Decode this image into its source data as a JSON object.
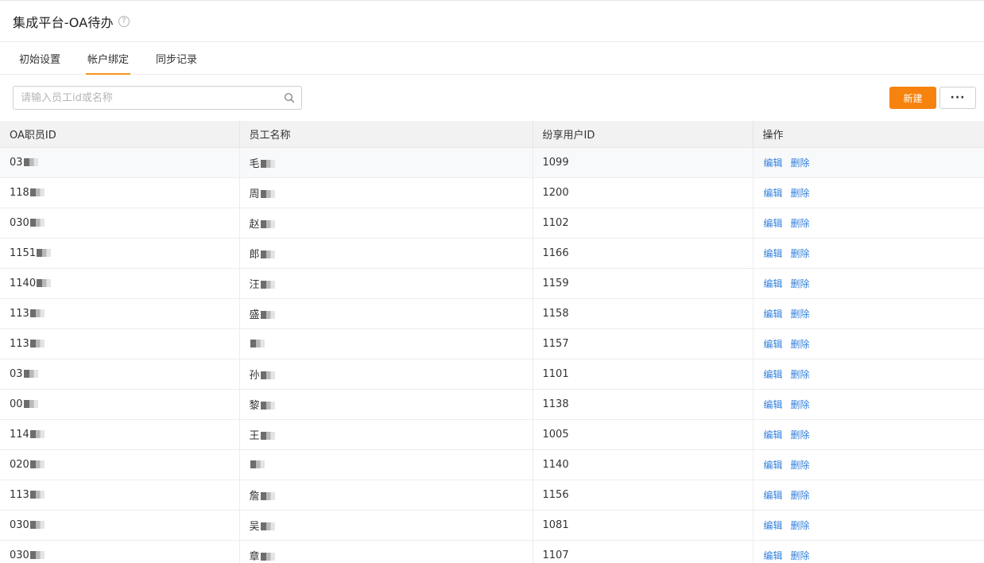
{
  "header": {
    "title": "集成平台-OA待办",
    "help_icon": "question-circle-icon"
  },
  "tabs": [
    {
      "label": "初始设置",
      "active": false
    },
    {
      "label": "帐户绑定",
      "active": true
    },
    {
      "label": "同步记录",
      "active": false
    }
  ],
  "toolbar": {
    "search_placeholder": "请输入员工id或名称",
    "search_value": "",
    "new_label": "新建",
    "more_label": "···"
  },
  "table": {
    "columns": [
      "OA职员ID",
      "员工名称",
      "纷享用户ID",
      "操作"
    ],
    "actions": {
      "edit": "编辑",
      "delete": "删除"
    },
    "rows": [
      {
        "oa_id": "03",
        "name": "毛",
        "share_id": "1099"
      },
      {
        "oa_id": "118",
        "name": "周",
        "share_id": "1200"
      },
      {
        "oa_id": "030",
        "name": "赵",
        "share_id": "1102"
      },
      {
        "oa_id": "1151",
        "name": "郎",
        "share_id": "1166"
      },
      {
        "oa_id": "1140",
        "name": "汪",
        "share_id": "1159"
      },
      {
        "oa_id": "113",
        "name": "盛",
        "share_id": "1158"
      },
      {
        "oa_id": "113",
        "name": "",
        "share_id": "1157"
      },
      {
        "oa_id": "03",
        "name": "孙",
        "share_id": "1101"
      },
      {
        "oa_id": "00",
        "name": "黎",
        "share_id": "1138"
      },
      {
        "oa_id": "114",
        "name": "王",
        "share_id": "1005"
      },
      {
        "oa_id": "020",
        "name": "",
        "share_id": "1140"
      },
      {
        "oa_id": "113",
        "name": "詹",
        "share_id": "1156"
      },
      {
        "oa_id": "030",
        "name": "吴",
        "share_id": "1081"
      },
      {
        "oa_id": "030",
        "name": "章",
        "share_id": "1107"
      }
    ]
  },
  "colors": {
    "accent": "#f7830f",
    "link": "#2f7fdc",
    "header_bg": "#f2f2f2"
  }
}
